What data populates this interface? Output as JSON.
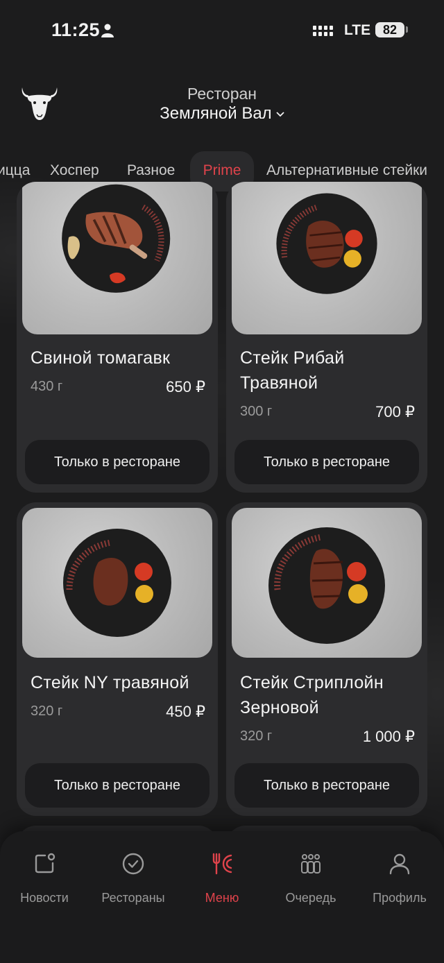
{
  "status_bar": {
    "time": "11:25",
    "network": "LTE",
    "battery": "82"
  },
  "header": {
    "caption": "Ресторан",
    "restaurant": "Земляной Вал"
  },
  "tabs": [
    {
      "label": "ицца"
    },
    {
      "label": "Хоспер"
    },
    {
      "label": "Разное"
    },
    {
      "label": "Prime",
      "active": true
    },
    {
      "label": "Альтернативные стейки"
    }
  ],
  "products": [
    {
      "name": "Свиной томагавк",
      "weight": "430 г",
      "price": "650 ₽",
      "button": "Только в ресторане"
    },
    {
      "name": "Стейк Рибай Травяной",
      "weight": "300 г",
      "price": "700 ₽",
      "button": "Только в ресторане"
    },
    {
      "name": "Стейк NY травяной",
      "weight": "320 г",
      "price": "450 ₽",
      "button": "Только в ресторане"
    },
    {
      "name": "Стейк Стриплойн Зерновой",
      "weight": "320 г",
      "price": "1 000 ₽",
      "button": "Только в ресторане"
    }
  ],
  "bottom_nav": [
    {
      "label": "Новости",
      "icon": "news-icon"
    },
    {
      "label": "Рестораны",
      "icon": "check-circle-icon"
    },
    {
      "label": "Меню",
      "icon": "fork-knife-icon",
      "active": true
    },
    {
      "label": "Очередь",
      "icon": "queue-icon"
    },
    {
      "label": "Профиль",
      "icon": "profile-icon"
    }
  ],
  "colors": {
    "accent": "#e0434b",
    "background": "#1c1c1d",
    "card": "#2c2c2e"
  }
}
